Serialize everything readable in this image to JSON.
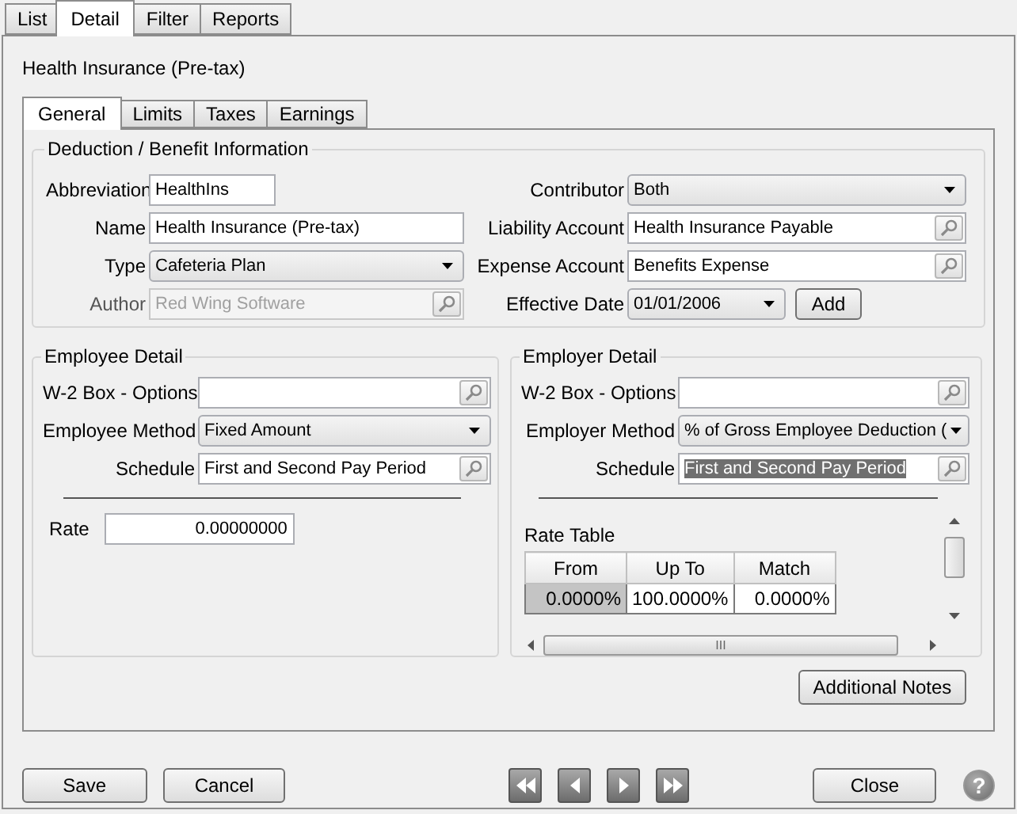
{
  "outer_tabs": [
    {
      "label": "List",
      "selected": false
    },
    {
      "label": "Detail",
      "selected": true
    },
    {
      "label": "Filter",
      "selected": false
    },
    {
      "label": "Reports",
      "selected": false
    }
  ],
  "record_title": "Health Insurance (Pre-tax)",
  "inner_tabs": [
    {
      "label": "General",
      "selected": true
    },
    {
      "label": "Limits",
      "selected": false
    },
    {
      "label": "Taxes",
      "selected": false
    },
    {
      "label": "Earnings",
      "selected": false
    }
  ],
  "deduction_info": {
    "title": "Deduction / Benefit Information",
    "left_fields": [
      {
        "label": "Abbreviation",
        "value": "HealthIns",
        "kind": "short",
        "disabled": false
      },
      {
        "label": "Name",
        "value": "Health Insurance (Pre-tax)",
        "kind": "text",
        "disabled": false
      },
      {
        "label": "Type",
        "value": "Cafeteria Plan",
        "kind": "select",
        "disabled": false
      },
      {
        "label": "Author",
        "value": "Red Wing Software",
        "kind": "lookup",
        "disabled": true
      }
    ],
    "right_fields": [
      {
        "label": "Contributor",
        "value": "Both",
        "kind": "select",
        "disabled": false
      },
      {
        "label": "Liability Account",
        "value": "Health Insurance Payable",
        "kind": "lookup",
        "disabled": false
      },
      {
        "label": "Expense Account",
        "value": "Benefits Expense",
        "kind": "lookup",
        "disabled": false
      },
      {
        "label": "Effective Date",
        "value": "01/01/2006",
        "kind": "date",
        "disabled": false,
        "button": "Add"
      }
    ]
  },
  "employee_detail": {
    "title": "Employee Detail",
    "fields": [
      {
        "label": "W-2 Box - Options",
        "kind": "lookup"
      },
      {
        "label": "Employee Method",
        "value": "Fixed Amount",
        "kind": "select"
      },
      {
        "label": "Schedule",
        "value": "First and Second Pay Period",
        "kind": "lookup"
      }
    ],
    "rate": {
      "label": "Rate",
      "value": "0.00000000"
    }
  },
  "employer_detail": {
    "title": "Employer Detail",
    "fields": [
      {
        "label": "W-2 Box - Options",
        "kind": "lookup"
      },
      {
        "label": "Employer Method",
        "value": "% of Gross Employee Deduction (",
        "kind": "select"
      },
      {
        "label": "Schedule",
        "value": "First and Second Pay Period",
        "kind": "lookup",
        "highlighted": true
      }
    ],
    "rate_table": {
      "title": "Rate Table",
      "columns": [
        "From",
        "Up To",
        "Match"
      ],
      "rows": [
        [
          {
            "text": "0.0000%",
            "selected": true
          },
          {
            "text": "100.0000%",
            "selected": false
          },
          {
            "text": "0.0000%",
            "selected": false
          }
        ]
      ],
      "scrollbar": "III"
    }
  },
  "notes_button": "Additional Notes",
  "footer": {
    "save": "Save",
    "cancel": "Cancel",
    "nav": [
      {
        "kind": "first"
      },
      {
        "kind": "previous"
      },
      {
        "kind": "next"
      },
      {
        "kind": "last"
      }
    ],
    "close": "Close",
    "help": "?"
  }
}
